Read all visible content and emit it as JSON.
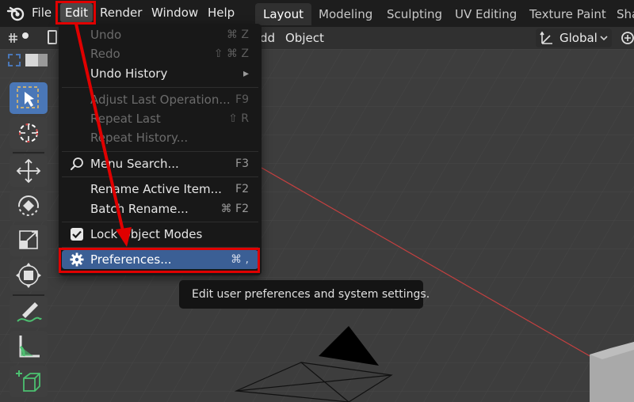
{
  "menubar": {
    "items": [
      "File",
      "Edit",
      "Render",
      "Window",
      "Help"
    ]
  },
  "workspace_tabs": [
    "Layout",
    "Modeling",
    "Sculpting",
    "UV Editing",
    "Texture Paint",
    "Sha"
  ],
  "header": {
    "menus": [
      "dd",
      "Object"
    ],
    "orientation_label": "Global"
  },
  "edit_menu": {
    "undo": {
      "label": "Undo",
      "shortcut": "⌘ Z"
    },
    "redo": {
      "label": "Redo",
      "shortcut": "⇧ ⌘ Z"
    },
    "undo_history": {
      "label": "Undo History",
      "shortcut": "▸"
    },
    "adjust_last": {
      "label": "Adjust Last Operation...",
      "shortcut": "F9"
    },
    "repeat_last": {
      "label": "Repeat Last",
      "shortcut": "⇧ R"
    },
    "repeat_history": {
      "label": "Repeat History..."
    },
    "menu_search": {
      "label": "Menu Search...",
      "shortcut": "F3"
    },
    "rename_active": {
      "label": "Rename Active Item...",
      "shortcut": "F2"
    },
    "batch_rename": {
      "label": "Batch Rename...",
      "shortcut": "⌘ F2"
    },
    "lock_object_modes": {
      "label": "Lock Object Modes"
    },
    "preferences": {
      "label": "Preferences...",
      "shortcut": "⌘ ,"
    }
  },
  "tooltip": {
    "text": "Edit user preferences and system settings."
  },
  "colors": {
    "annotation": "#e00000",
    "highlight": "#3b5f95",
    "tool_active": "#4a77b7",
    "x_axis": "#c44040"
  }
}
